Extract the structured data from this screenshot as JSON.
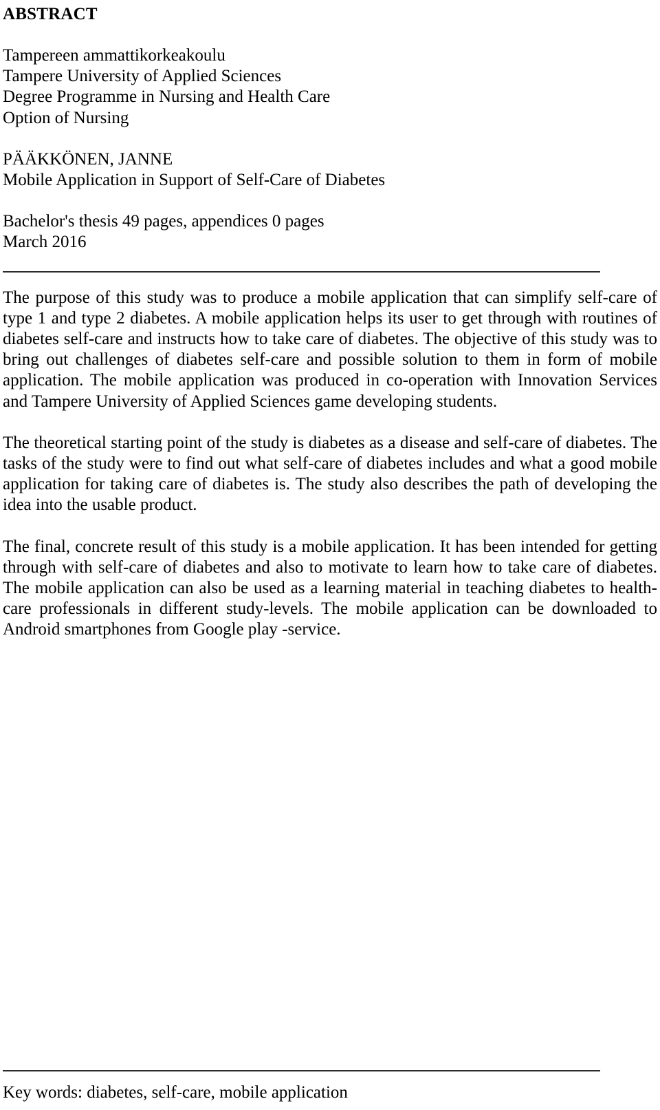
{
  "document": {
    "heading": "ABSTRACT",
    "institution": {
      "line1": "Tampereen ammattikorkeakoulu",
      "line2": "Tampere University of Applied Sciences",
      "line3": "Degree Programme in Nursing and Health Care",
      "line4": "Option of Nursing"
    },
    "author": {
      "name": "PÄÄKKÖNEN, JANNE",
      "title": "Mobile Application in Support of Self-Care of Diabetes"
    },
    "thesis_details": {
      "pages": "Bachelor's thesis 49 pages, appendices 0 pages",
      "date": "March 2016"
    },
    "body": {
      "paragraph_1": "The purpose of this study was to produce a mobile application that can simplify self-care of type 1 and type 2 diabetes. A mobile application helps its user to get through with routines of diabetes self-care and instructs how to take care of diabetes. The objective of this study was to bring out challenges of diabetes self-care and possible solution to them in form of mobile application. The mobile application was produced in co-operation with Innovation Services and Tampere University of Applied Sciences game developing stu­dents.",
      "paragraph_2": "The theoretical starting point of the study is diabetes as a disease and self-care of diabetes. The tasks of the study were to find out what self-care of diabetes includes and what a good mobile application for taking care of diabetes is. The study also describes the path of developing the idea into the usable product.",
      "paragraph_3": "The final, concrete result of this study is a mobile application. It has been intended for getting through with self-care of diabetes and also to motivate to learn how to take care of diabetes. The mobile application can also be used as a learning material in teaching diabetes to health-care professionals in different study-levels. The mobile application can be downloaded to Android smartphones from Google play -service."
    },
    "keywords": "Key words: diabetes, self-care, mobile application"
  }
}
